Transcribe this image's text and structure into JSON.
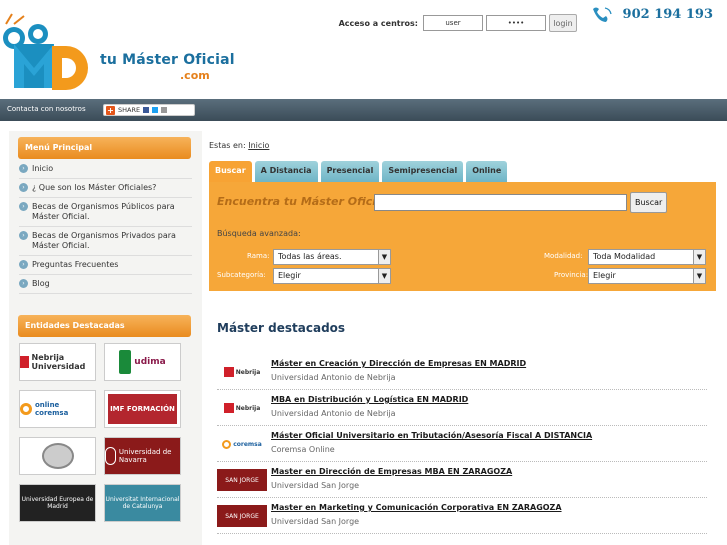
{
  "header": {
    "brand_line1": "tu Máster Oficial",
    "brand_line2": ".com",
    "login_label": "Acceso a centros:",
    "user_value": "user",
    "pass_value": "••••",
    "login_button": "login",
    "phone": "902 194 193"
  },
  "navbar": {
    "contact": "Contacta con nosotros",
    "share": "SHARE"
  },
  "sidebar": {
    "menu_title": "Menú Principal",
    "items": [
      {
        "label": "Inicio"
      },
      {
        "label": "¿ Que son los Máster Oficiales?"
      },
      {
        "label": "Becas de Organismos Públicos para Máster Oficial."
      },
      {
        "label": "Becas de Organismos Privados para Máster Oficial."
      },
      {
        "label": "Preguntas Frecuentes"
      },
      {
        "label": "Blog"
      }
    ],
    "entities_title": "Entidades Destacadas",
    "entities": [
      {
        "name": "Nebrija Universidad"
      },
      {
        "name": "udima"
      },
      {
        "name": "online coremsa"
      },
      {
        "name": "IMF FORMACIÓN"
      },
      {
        "name": ""
      },
      {
        "name": "Universidad de Navarra"
      },
      {
        "name": "Universidad Europea de Madrid"
      },
      {
        "name": "Universitat Internacional de Catalunya"
      }
    ]
  },
  "main": {
    "breadcrumb_prefix": "Estas en:",
    "breadcrumb_link": "Inicio",
    "tabs": [
      {
        "label": "Buscar"
      },
      {
        "label": "A Distancia"
      },
      {
        "label": "Presencial"
      },
      {
        "label": "Semipresencial"
      },
      {
        "label": "Online"
      }
    ],
    "search": {
      "heading": "Encuentra tu Máster Oficial:",
      "button": "Buscar",
      "advanced": "Búsqueda avanzada:",
      "rama_label": "Rama:",
      "rama_value": "Todas las áreas.",
      "modalidad_label": "Modalidad:",
      "modalidad_value": "Toda Modalidad",
      "subcategoria_label": "Subcategoría:",
      "subcategoria_value": "Elegir",
      "provincia_label": "Provincia:",
      "provincia_value": "Elegir"
    },
    "featured_title": "Máster destacados",
    "featured": [
      {
        "title": "Máster en Creación y Dirección de Empresas EN MADRID",
        "school": "Universidad Antonio de Nebrija",
        "logo": "Nebrija"
      },
      {
        "title": "MBA en Distribución y Logística EN MADRID",
        "school": "Universidad Antonio de Nebrija",
        "logo": "Nebrija"
      },
      {
        "title": "Máster Oficial Universitario en Tributación/Asesoría Fiscal A DISTANCIA",
        "school": "Coremsa Online",
        "logo": "coremsa"
      },
      {
        "title": "Master en Dirección de Empresas MBA EN ZARAGOZA",
        "school": "Universidad San Jorge",
        "logo": "SAN JORGE"
      },
      {
        "title": "Master en Marketing y Comunicación Corporativa EN ZARAGOZA",
        "school": "Universidad San Jorge",
        "logo": "SAN JORGE"
      }
    ]
  },
  "colors": {
    "orange": "#f6a739",
    "blue": "#1b6f9e",
    "tab_blue": "#7dbdcc",
    "nav_dark": "#3b4c58"
  }
}
